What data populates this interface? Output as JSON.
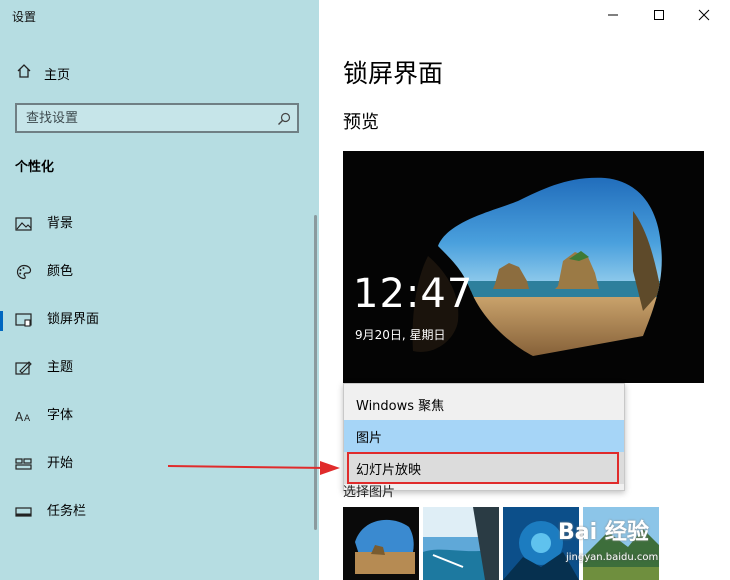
{
  "window": {
    "title": "设置"
  },
  "sidebar": {
    "home_label": "主页",
    "search_placeholder": "查找设置",
    "section_title": "个性化",
    "items": [
      {
        "label": "背景",
        "icon": "picture-icon"
      },
      {
        "label": "颜色",
        "icon": "palette-icon"
      },
      {
        "label": "锁屏界面",
        "icon": "lockscreen-icon",
        "active": true
      },
      {
        "label": "主题",
        "icon": "theme-icon"
      },
      {
        "label": "字体",
        "icon": "font-icon"
      },
      {
        "label": "开始",
        "icon": "start-icon"
      },
      {
        "label": "任务栏",
        "icon": "taskbar-icon"
      }
    ]
  },
  "main": {
    "page_title": "锁屏界面",
    "preview_title": "预览",
    "preview": {
      "time": "12:47",
      "date": "9月20日, 星期日"
    },
    "background_dropdown": {
      "options": [
        "Windows 聚焦",
        "图片",
        "幻灯片放映"
      ],
      "selected": "图片",
      "highlighted": "幻灯片放映"
    },
    "choose_label": "选择图片"
  },
  "watermark": {
    "logo": "Bai 经验",
    "url": "jingyan.baidu.com"
  },
  "colors": {
    "sidebar_bg": "#b6dde2",
    "accent": "#0067c0",
    "selected_bg": "#a6d5f7",
    "annotation_red": "#e02b2b"
  }
}
